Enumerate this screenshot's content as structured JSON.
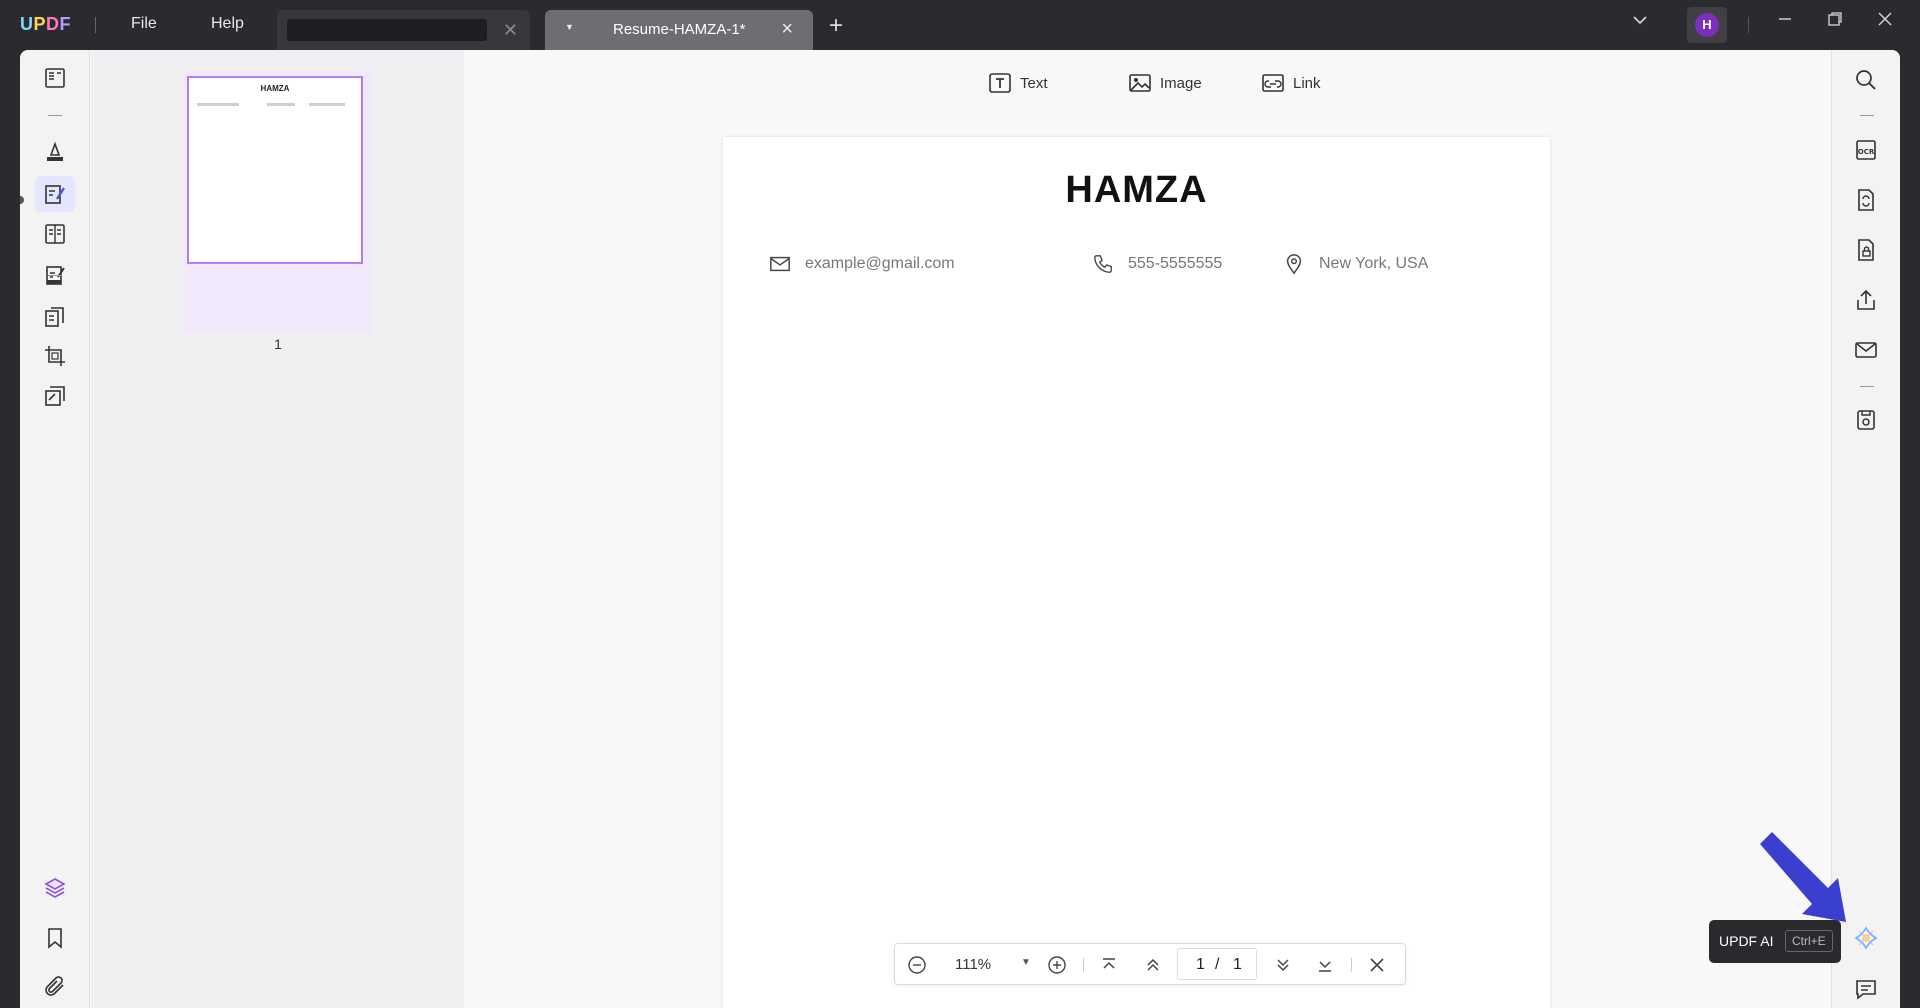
{
  "app": {
    "logo": "UPDF",
    "menu": [
      "File",
      "Help"
    ]
  },
  "tabs": {
    "active_label": "Resume-HAMZA-1*"
  },
  "user": {
    "avatar_initial": "H"
  },
  "edit_toolbar": {
    "text_label": "Text",
    "image_label": "Image",
    "link_label": "Link"
  },
  "thumbnails": {
    "page_name": "HAMZA",
    "page_number": "1"
  },
  "document": {
    "name": "HAMZA",
    "email": "example@gmail.com",
    "phone": "555-5555555",
    "location": "New York, USA"
  },
  "zoom_bar": {
    "zoom": "111%",
    "current_page": "1",
    "page_separator": "/",
    "total_pages": "1"
  },
  "tooltip": {
    "label": "UPDF AI",
    "shortcut": "Ctrl+E"
  },
  "colors": {
    "accent_purple": "#b77bf2",
    "arrow_blue": "#3b3fd0",
    "avatar": "#7a2fbd"
  }
}
